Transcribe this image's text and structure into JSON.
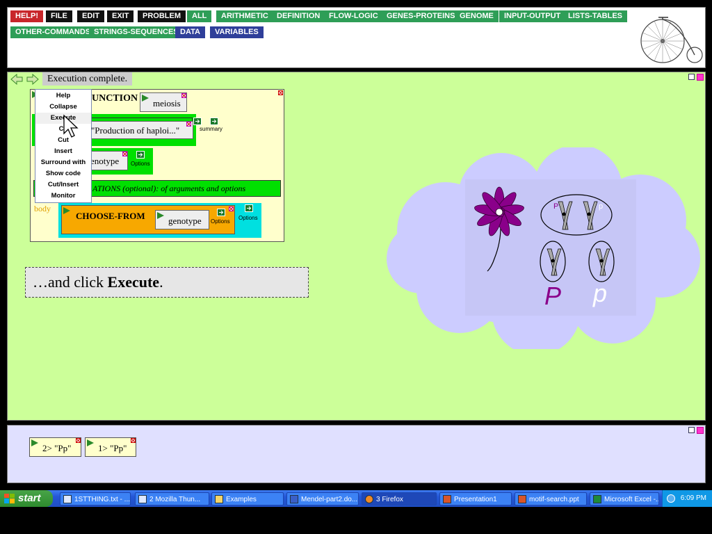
{
  "menu": {
    "buttons": [
      {
        "label": "HELP!"
      },
      {
        "label": "FILE"
      },
      {
        "label": "EDIT"
      },
      {
        "label": "EXIT"
      },
      {
        "label": "PROBLEM"
      },
      {
        "label": "ALL"
      },
      {
        "label": "ARITHMETIC"
      },
      {
        "label": "DEFINITION"
      },
      {
        "label": "FLOW-LOGIC"
      },
      {
        "label": "GENES-PROTEINS"
      },
      {
        "label": "GENOME"
      },
      {
        "label": "INPUT-OUTPUT"
      },
      {
        "label": "LISTS-TABLES"
      },
      {
        "label": "OTHER-COMMANDS"
      },
      {
        "label": "STRINGS-SEQUENCES"
      },
      {
        "label": "DATA"
      },
      {
        "label": "VARIABLES"
      }
    ],
    "colors": {
      "red": "#c8262a",
      "black": "#111111",
      "green": "#2e9e57",
      "blue": "#2f3f9a"
    }
  },
  "work": {
    "status": "Execution complete.",
    "function_box": {
      "keyword": "UNCTION",
      "name": "meiosis",
      "summary_value": "\"Production of haploi...\"",
      "summary_label": "summary",
      "param_value": "enotype",
      "options_label": "Options",
      "declarations": "ATIONS (optional): of arguments and options",
      "body_label": "body",
      "choose_keyword": "CHOOSE-FROM",
      "choose_arg": "genotype",
      "choose_options": "Options",
      "outer_options": "Options"
    },
    "context_menu": [
      "Help",
      "Collapse",
      "Execute",
      "Co",
      "Cut",
      "Insert",
      "Surround with",
      "Show code",
      "Cut/Insert",
      "Monitor"
    ],
    "instruction": {
      "prefix": "…and click ",
      "bold": "Execute",
      "suffix": "."
    },
    "illustration": {
      "allele_dominant": "P",
      "allele_recessive": "p",
      "chrom_label_dominant": "P",
      "chrom_label_recessive": "p"
    }
  },
  "results": [
    {
      "label": "2> \"Pp\""
    },
    {
      "label": "1> \"Pp\""
    }
  ],
  "taskbar": {
    "start_label": "start",
    "tasks": [
      {
        "label": "1STTHING.txt - ..."
      },
      {
        "label": "2 Mozilla Thun..."
      },
      {
        "label": "Examples"
      },
      {
        "label": "Mendel-part2.do..."
      },
      {
        "label": "3 Firefox"
      },
      {
        "label": "Presentation1"
      },
      {
        "label": "motif-search.ppt"
      },
      {
        "label": "Microsoft Excel -..."
      }
    ],
    "clock": "6:09 PM"
  }
}
